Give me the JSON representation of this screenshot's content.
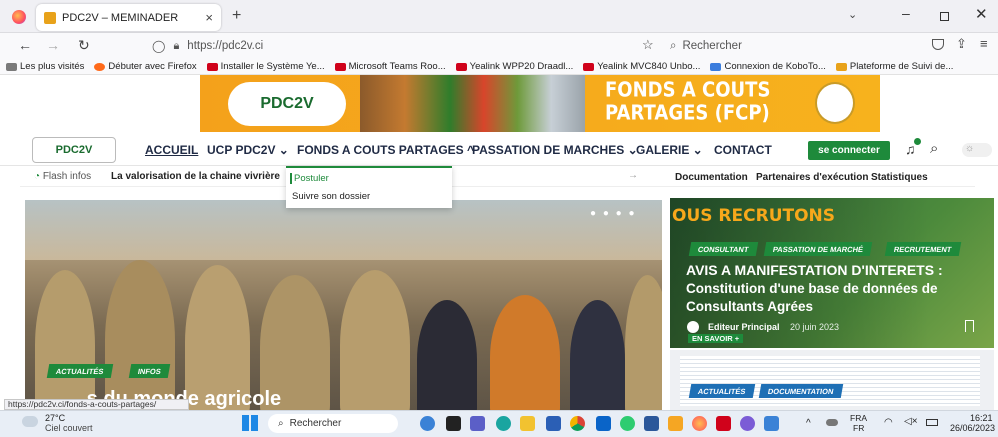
{
  "browser": {
    "tab_title": "PDC2V – MEMINADER",
    "new_tab": "+",
    "url": "https://pdc2v.ci",
    "search_placeholder": "Rechercher",
    "bookmarks": [
      {
        "label": "Les plus visités",
        "color": "#7a7a7a"
      },
      {
        "label": "Débuter avec Firefox",
        "color": "#ff6a1a"
      },
      {
        "label": "Installer le Système Ye...",
        "color": "#d0021b"
      },
      {
        "label": "Microsoft Teams Roo...",
        "color": "#d0021b"
      },
      {
        "label": "Yealink WPP20 Draadl...",
        "color": "#d0021b"
      },
      {
        "label": "Yealink MVC840 Unbo...",
        "color": "#d0021b"
      },
      {
        "label": "Connexion de KoboTo...",
        "color": "#3b7ddd"
      },
      {
        "label": "Plateforme de Suivi de...",
        "color": "#e8a21a"
      }
    ],
    "status_url": "https://pdc2v.ci/fonds-a-couts-partages/"
  },
  "banner": {
    "logo_text": "PDC2V",
    "title_line1": "FONDS A COUTS",
    "title_line2": "PARTAGES (FCP)"
  },
  "nav": {
    "logo_text": "PDC2V",
    "items": [
      {
        "label": "ACCUEIL"
      },
      {
        "label": "UCP PDC2V ⌄"
      },
      {
        "label": "FONDS A COUTS PARTAGES ^"
      },
      {
        "label": "PASSATION DE MARCHES ⌄"
      },
      {
        "label": "GALERIE ⌄"
      },
      {
        "label": "CONTACT"
      }
    ],
    "login": "se connecter"
  },
  "dropdown": {
    "items": [
      "Postuler",
      "Suivre son dossier"
    ]
  },
  "flash": {
    "label": "Flash infos",
    "text": "La valorisation de la chaine vivrière",
    "links": [
      "Documentation",
      "Partenaires d'exécution",
      "Statistiques"
    ]
  },
  "hero": {
    "tags": [
      "ACTUALITÉS",
      "INFOS"
    ],
    "headline": "...s du monde agricole"
  },
  "card": {
    "kicker": "OUS RECRUTONS",
    "tags": [
      "CONSULTANT",
      "PASSATION DE MARCHÉ",
      "RECRUTEMENT"
    ],
    "title_line1": "AVIS A MANIFESTATION D'INTERETS :",
    "title_line2": "Constitution d'une base de données de",
    "title_line3": "Consultants Agrées",
    "author": "Editeur Principal",
    "date": "20 juin 2023",
    "more": "EN SAVOIR +"
  },
  "card2": {
    "tags": [
      "ACTUALITÉS",
      "DOCUMENTATION"
    ]
  },
  "taskbar": {
    "weather_temp": "27°C",
    "weather_desc": "Ciel couvert",
    "search": "Rechercher",
    "lang1": "FRA",
    "lang2": "FR",
    "time": "16:21",
    "date": "26/06/2023"
  }
}
